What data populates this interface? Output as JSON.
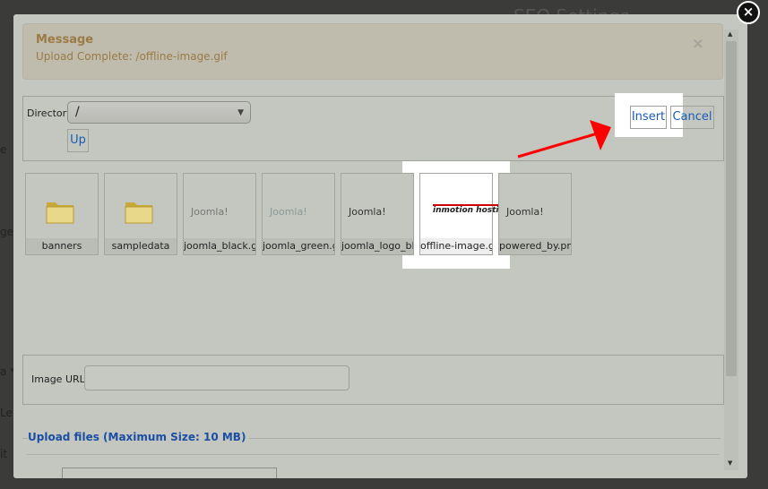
{
  "background": {
    "heading": "SEO Settings",
    "side_fragments": [
      "e",
      "ge",
      "a *",
      "Le",
      "it"
    ]
  },
  "message": {
    "title": "Message",
    "text": "Upload Complete: /offline-image.gif",
    "close": "×"
  },
  "directory": {
    "label": "Directory",
    "value": "/",
    "up_label": "Up"
  },
  "actions": {
    "insert": "Insert",
    "cancel": "Cancel"
  },
  "files": [
    {
      "name": "banners",
      "type": "folder"
    },
    {
      "name": "sampledata",
      "type": "folder"
    },
    {
      "name": "joomla_black.gif",
      "type": "image",
      "logo": "Joomla!"
    },
    {
      "name": "joomla_green.gif",
      "type": "image",
      "logo": "Joomla!"
    },
    {
      "name": "joomla_logo_black.gif",
      "type": "image",
      "logo": "Joomla!"
    },
    {
      "name": "offline-image.gif",
      "type": "image",
      "logo": "inmotion hosting"
    },
    {
      "name": "powered_by.png",
      "type": "image",
      "logo": "Joomla!"
    }
  ],
  "image_url": {
    "label": "Image URL",
    "value": ""
  },
  "upload": {
    "title": "Upload files (Maximum Size: 10 MB)"
  },
  "colors": {
    "accent": "#1b5bb3",
    "arrow": "#ff0000"
  }
}
